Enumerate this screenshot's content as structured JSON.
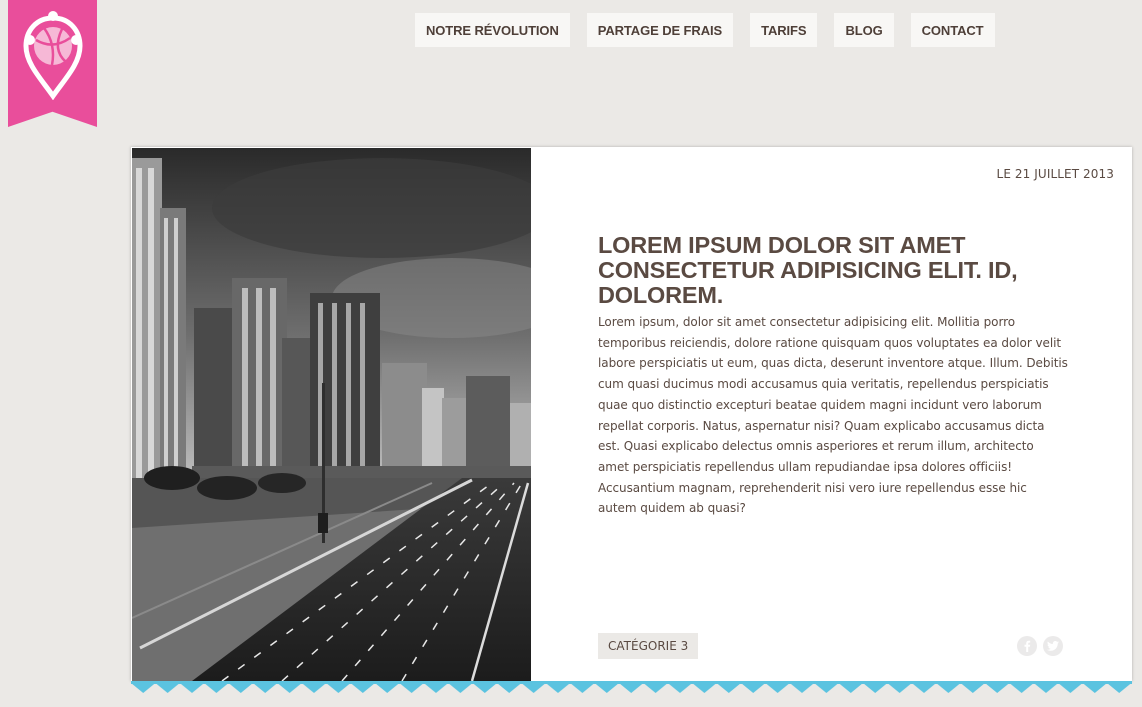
{
  "brand": {
    "logo_icon": "map-pin-dribbble-icon",
    "ribbon_color": "#e94e9b"
  },
  "nav": {
    "items": [
      {
        "label": "NOTRE RÉVOLUTION"
      },
      {
        "label": "PARTAGE DE FRAIS"
      },
      {
        "label": "TARIFS"
      },
      {
        "label": "BLOG"
      },
      {
        "label": "CONTACT"
      }
    ]
  },
  "article": {
    "date": "LE 21 JUILLET 2013",
    "title": "LOREM IPSUM DOLOR SIT AMET CONSECTETUR ADIPISICING ELIT. ID, DOLOREM.",
    "body": "Lorem ipsum, dolor sit amet consectetur adipisicing elit. Mollitia porro temporibus reiciendis, dolore ratione quisquam quos voluptates ea dolor velit labore perspiciatis ut eum, quas dicta, deserunt inventore atque. Illum. Debitis cum quasi ducimus modi accusamus quia veritatis, repellendus perspiciatis quae quo distinctio excepturi beatae quidem magni incidunt vero laborum repellat corporis. Natus, aspernatur nisi? Quam explicabo accusamus dicta est. Quasi explicabo delectus omnis asperiores et rerum illum, architecto amet perspiciatis repellendus ullam repudiandae ipsa dolores officiis! Accusantium magnam, reprehenderit nisi vero iure repellendus esse hic autem quidem ab quasi?",
    "category": "CATÉGORIE 3",
    "image_icon": "city-highway-photo",
    "social": [
      {
        "icon": "facebook-icon"
      },
      {
        "icon": "twitter-icon"
      }
    ]
  },
  "colors": {
    "page_bg": "#ebe9e6",
    "text": "#5a4a42",
    "accent_pink": "#e94e9b",
    "zigzag_blue": "#5bc3e0"
  }
}
